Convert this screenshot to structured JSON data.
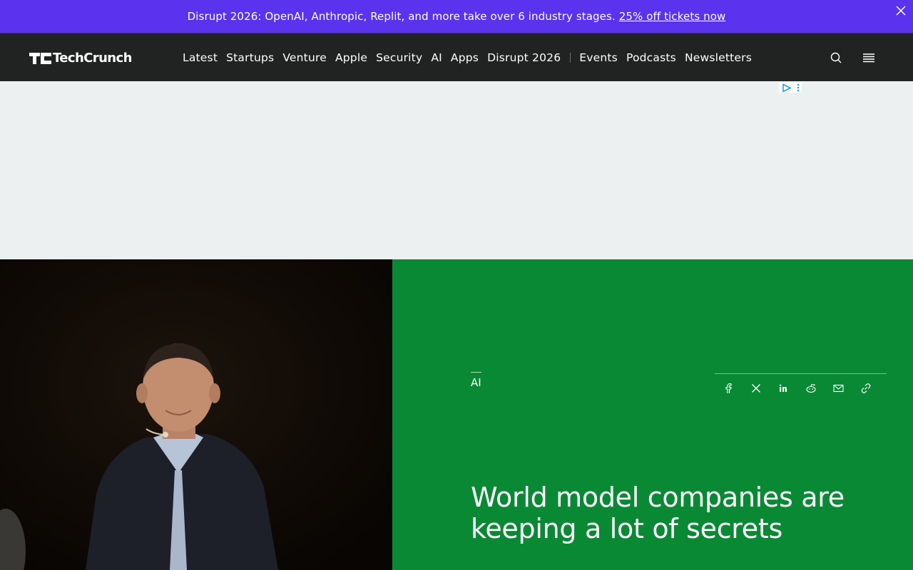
{
  "promo": {
    "text": "Disrupt 2026: OpenAI, Anthropic, Replit, and more take over 6 industry stages.",
    "link": "25% off tickets now"
  },
  "header": {
    "logo_text": "TechCrunch",
    "nav": [
      "Latest",
      "Startups",
      "Venture",
      "Apple",
      "Security",
      "AI",
      "Apps",
      "Disrupt 2026"
    ],
    "nav_secondary": [
      "Events",
      "Podcasts",
      "Newsletters"
    ]
  },
  "article": {
    "category": "AI",
    "headline": "World model companies are keeping a lot of secrets",
    "share_icons": [
      "facebook-icon",
      "x-icon",
      "linkedin-icon",
      "reddit-icon",
      "email-icon",
      "link-icon"
    ]
  },
  "colors": {
    "promo_bg": "#5b32ee",
    "header_bg": "#212322",
    "hero_green": "#0a8935",
    "ad_bg": "#edf0f0"
  }
}
